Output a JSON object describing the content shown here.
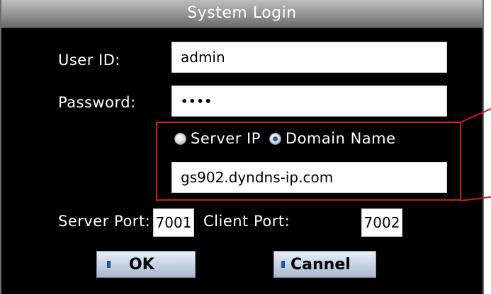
{
  "dialog": {
    "title": "System Login"
  },
  "login": {
    "user_id_label": "User ID:",
    "user_id_value": "admin",
    "password_label": "Password:",
    "password_value": "••••"
  },
  "server": {
    "server_ip_label": "Server IP",
    "domain_name_label": "Domain Name",
    "selected_option": "Domain Name",
    "address_value": "gs902.dyndns-ip.com"
  },
  "ports": {
    "server_port_label": "Server Port:",
    "server_port_value": "7001",
    "client_port_label": "Client Port:",
    "client_port_value": "7002"
  },
  "buttons": {
    "ok_label": "OK",
    "cancel_label": "Cannel"
  },
  "colors": {
    "dialog_background": "#000000",
    "highlight": "#d71a1a",
    "radio_selected": "#1f5fb3"
  }
}
